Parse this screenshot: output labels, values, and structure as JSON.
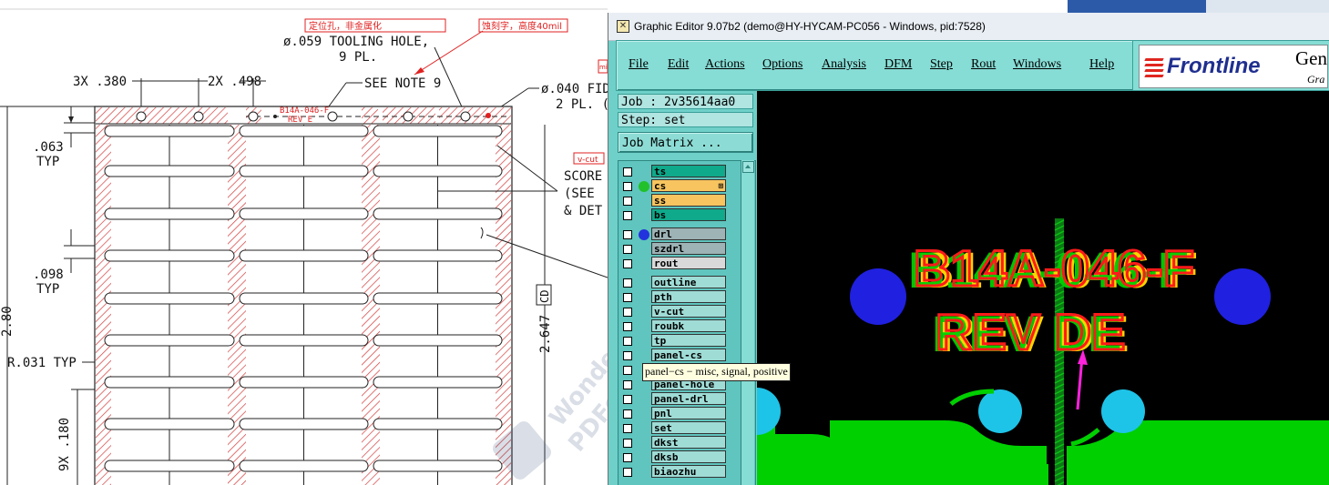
{
  "drawing": {
    "note_red_1": "定位孔，非金属化",
    "note_red_2": "蚀刻字，高度40mil",
    "tooling_hole_line1": "ø.059 TOOLING HOLE,",
    "tooling_hole_line2": "9 PL.",
    "dim_3x": "3X .380",
    "dim_2x": "2X .498",
    "see_note_9": "SEE NOTE 9",
    "fid_line1": "ø.040 FID",
    "fid_line2": "2 PL. (",
    "panel_text_1": "B14A-046-F",
    "panel_text_2": "REV E",
    "dim_063": ".063",
    "typ_1": "TYP",
    "dim_098": ".098",
    "typ_2": "TYP",
    "radius": "R.031 TYP",
    "dim_180": "9X .180",
    "dim_2647": "2.647",
    "cd_box": "CD",
    "dim_280": "2.80",
    "vcut_tag": "v-cut",
    "score_1": "SCORE",
    "score_2": "(SEE",
    "score_3": "& DET",
    "mini_tag": "mi",
    "watermark_1": "Wonde",
    "watermark_2": "PDFe"
  },
  "window": {
    "title": "Graphic Editor 9.07b2 (demo@HY-HYCAM-PC056 - Windows, pid:7528)"
  },
  "menu": {
    "file": "File",
    "edit": "Edit",
    "actions": "Actions",
    "options": "Options",
    "analysis": "Analysis",
    "dfm": "DFM",
    "step": "Step",
    "rout": "Rout",
    "windows": "Windows",
    "help": "Help"
  },
  "brand": {
    "word": "Frontline",
    "gen": "Gen",
    "sub": "Gra"
  },
  "info": {
    "job": "Job : 2v35614aa0",
    "step": "Step: set",
    "job_matrix": "Job Matrix ..."
  },
  "layers": [
    {
      "name": "ts",
      "kind": "board",
      "dot": ""
    },
    {
      "name": "cs",
      "kind": "active",
      "dot": "#22c02a"
    },
    {
      "name": "ss",
      "kind": "active",
      "dot": ""
    },
    {
      "name": "bs",
      "kind": "board",
      "dot": ""
    },
    {
      "name": "drl",
      "kind": "drill",
      "dot": "#2233dd"
    },
    {
      "name": "szdrl",
      "kind": "drill",
      "dot": ""
    },
    {
      "name": "rout",
      "kind": "rout",
      "dot": ""
    },
    {
      "name": "outline",
      "kind": "misc",
      "dot": ""
    },
    {
      "name": "pth",
      "kind": "misc",
      "dot": ""
    },
    {
      "name": "v-cut",
      "kind": "misc",
      "dot": ""
    },
    {
      "name": "roubk",
      "kind": "misc",
      "dot": ""
    },
    {
      "name": "tp",
      "kind": "misc",
      "dot": ""
    },
    {
      "name": "panel-cs",
      "kind": "misc",
      "dot": ""
    },
    {
      "name": "solder-x",
      "kind": "misc",
      "dot": ""
    },
    {
      "name": "panel-hole",
      "kind": "misc",
      "dot": ""
    },
    {
      "name": "panel-drl",
      "kind": "misc",
      "dot": ""
    },
    {
      "name": "pnl",
      "kind": "misc",
      "dot": ""
    },
    {
      "name": "set",
      "kind": "misc",
      "dot": ""
    },
    {
      "name": "dkst",
      "kind": "misc",
      "dot": ""
    },
    {
      "name": "dksb",
      "kind": "misc",
      "dot": ""
    },
    {
      "name": "biaozhu",
      "kind": "misc",
      "dot": ""
    }
  ],
  "tooltip": "panel−cs − misc, signal, positive",
  "canvas": {
    "text_line1": "B14A-046-F",
    "text_line2": "REV DE"
  },
  "colors": {
    "canvas_bg": "#000000",
    "copper_green": "#00d000",
    "etch_red": "#ff1a1a",
    "etch_yellow": "#ffd400",
    "drill_blue": "#2020e0",
    "pad_cyan": "#1ec3e8",
    "arrow_magenta": "#ff22dd"
  }
}
